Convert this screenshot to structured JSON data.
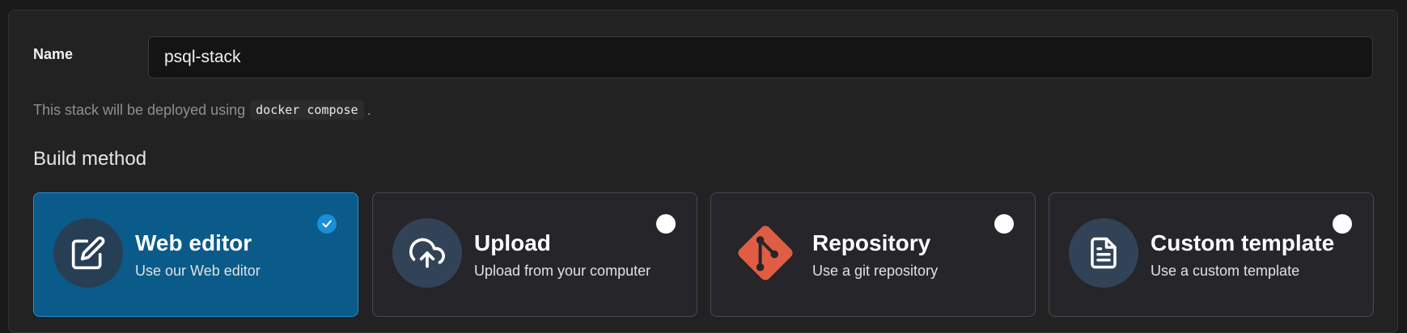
{
  "form": {
    "name_label": "Name",
    "name_value": "psql-stack",
    "hint_prefix": "This stack will be deployed using",
    "hint_code": "docker compose",
    "hint_suffix": "."
  },
  "build_method": {
    "title": "Build method",
    "options": [
      {
        "title": "Web editor",
        "subtitle": "Use our Web editor",
        "icon": "edit-icon",
        "selected": true
      },
      {
        "title": "Upload",
        "subtitle": "Upload from your computer",
        "icon": "cloud-upload-icon",
        "selected": false
      },
      {
        "title": "Repository",
        "subtitle": "Use a git repository",
        "icon": "git-icon",
        "selected": false
      },
      {
        "title": "Custom template",
        "subtitle": "Use a custom template",
        "icon": "file-text-icon",
        "selected": false
      }
    ]
  },
  "colors": {
    "selected_bg": "#0a5a8a",
    "selected_border": "#1e90d6",
    "git_orange": "#e05d44"
  }
}
